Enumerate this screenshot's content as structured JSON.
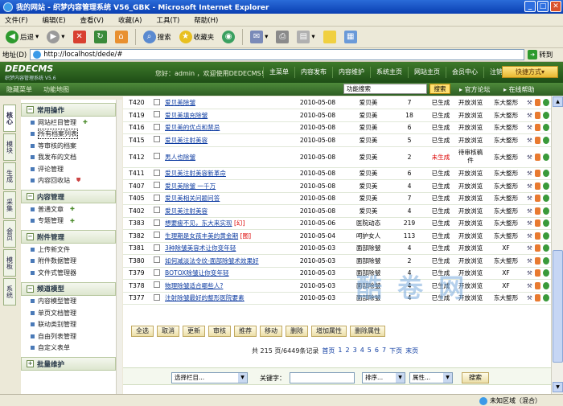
{
  "window": {
    "title": "我的网站 - 织梦内容管理系统 V56_GBK - Microsoft Internet Explorer"
  },
  "menu": [
    "文件(F)",
    "编辑(E)",
    "查看(V)",
    "收藏(A)",
    "工具(T)",
    "帮助(H)"
  ],
  "toolbar": {
    "back": "后退",
    "search": "搜索",
    "favorites": "收藏夹"
  },
  "address": {
    "label": "地址(D)",
    "url": "http://localhost/dede/#",
    "go": "转到"
  },
  "header": {
    "logo": "DEDECMS",
    "logo_sub": "织梦内容管理系统 V5.6",
    "welcome": "您好：admin ，欢迎使用DEDECMS！",
    "nav": [
      "主菜单",
      "内容发布",
      "内容维护",
      "系统主页",
      "网站主页",
      "会员中心",
      "注销"
    ],
    "quick": "快捷方式"
  },
  "subheader": {
    "links": [
      "隐藏菜单",
      "功能地图"
    ],
    "search_value": "功能搜索",
    "search_btn": "搜索",
    "forum": "官方论坛",
    "help": "在线帮助"
  },
  "vtabs": [
    "核心",
    "模块",
    "生成",
    "采集",
    "会员",
    "模板",
    "系统"
  ],
  "sidebar": [
    {
      "title": "常用操作",
      "items": [
        "网站栏目管理",
        "所有档案列表",
        "等审核的档案",
        "我发布的文档",
        "评论管理",
        "内容回收站"
      ]
    },
    {
      "title": "内容管理",
      "items": [
        "普通文章",
        "专题管理"
      ]
    },
    {
      "title": "附件管理",
      "items": [
        "上传新文件",
        "附件数据管理",
        "文件式管理器"
      ]
    },
    {
      "title": "频道模型",
      "items": [
        "内容模型管理",
        "单页文档管理",
        "联动类别管理",
        "自由列表管理",
        "自定义表单"
      ]
    },
    {
      "title": "批量维护",
      "items": []
    }
  ],
  "rows": [
    {
      "id": "T420",
      "title": "爱贝美除皱",
      "date": "2010-05-08",
      "cat": "爱贝美",
      "hits": "7",
      "status": "已生成",
      "perm": "开放浏览",
      "author": "东大整形"
    },
    {
      "id": "T419",
      "title": "爱贝美填充除皱",
      "date": "2010-05-08",
      "cat": "爱贝美",
      "hits": "18",
      "status": "已生成",
      "perm": "开放浏览",
      "author": "东大整形"
    },
    {
      "id": "T416",
      "title": "爱贝美的优点和禁忌",
      "date": "2010-05-08",
      "cat": "爱贝美",
      "hits": "6",
      "status": "已生成",
      "perm": "开放浏览",
      "author": "东大整形"
    },
    {
      "id": "T415",
      "title": "爱贝美注射美容",
      "date": "2010-05-08",
      "cat": "爱贝美",
      "hits": "5",
      "status": "已生成",
      "perm": "开放浏览",
      "author": "东大整形"
    },
    {
      "id": "T412",
      "title": "男人也除皱",
      "date": "2010-05-08",
      "cat": "爱贝美",
      "hits": "2",
      "status": "未生成",
      "perm": "待审核稿件",
      "author": "东大整形",
      "tall": true
    },
    {
      "id": "T411",
      "title": "爱贝美注射美容新革命",
      "date": "2010-05-08",
      "cat": "爱贝美",
      "hits": "6",
      "status": "已生成",
      "perm": "开放浏览",
      "author": "东大整形"
    },
    {
      "id": "T407",
      "title": "爱贝美除皱 一千万",
      "date": "2010-05-08",
      "cat": "爱贝美",
      "hits": "4",
      "status": "已生成",
      "perm": "开放浏览",
      "author": "东大整形"
    },
    {
      "id": "T405",
      "title": "爱贝美相关问题问答",
      "date": "2010-05-08",
      "cat": "爱贝美",
      "hits": "7",
      "status": "已生成",
      "perm": "开放浏览",
      "author": "东大整形"
    },
    {
      "id": "T402",
      "title": "爱贝美注射美容",
      "date": "2010-05-08",
      "cat": "爱贝美",
      "hits": "4",
      "status": "已生成",
      "perm": "开放浏览",
      "author": "东大整形"
    },
    {
      "id": "T383",
      "title": "想要瘦不见，东大来实现",
      "date": "2010-05-06",
      "cat": "医院动态",
      "hits": "219",
      "status": "已生成",
      "perm": "开放浏览",
      "author": "东大整形",
      "flag": "幻"
    },
    {
      "id": "T382",
      "title": "生理期是女孩丰美的黄金期",
      "date": "2010-05-04",
      "cat": "呵护女人",
      "hits": "113",
      "status": "已生成",
      "perm": "开放浏览",
      "author": "东大整形",
      "flag": "图"
    },
    {
      "id": "T381",
      "title": "3种除皱美容术让你变年轻",
      "date": "2010-05-03",
      "cat": "面部除皱",
      "hits": "4",
      "status": "已生成",
      "perm": "开放浏览",
      "author": "XF"
    },
    {
      "id": "T380",
      "title": "如何减淡法令纹-面部除皱术效果好",
      "date": "2010-05-03",
      "cat": "面部除皱",
      "hits": "2",
      "status": "已生成",
      "perm": "开放浏览",
      "author": "东大整形"
    },
    {
      "id": "T379",
      "title": "BOTOX除皱让你变年轻",
      "date": "2010-05-03",
      "cat": "面部除皱",
      "hits": "4",
      "status": "已生成",
      "perm": "开放浏览",
      "author": "XF"
    },
    {
      "id": "T378",
      "title": "物理除皱适合哪些人?",
      "date": "2010-05-03",
      "cat": "面部除皱",
      "hits": "4",
      "status": "已生成",
      "perm": "开放浏览",
      "author": "XF"
    },
    {
      "id": "T377",
      "title": "注射除皱最好的整形医院要素",
      "date": "2010-05-03",
      "cat": "面部除皱",
      "hits": "4",
      "status": "已生成",
      "perm": "开放浏览",
      "author": "东大整形"
    }
  ],
  "actions": [
    "全选",
    "取消",
    "更新",
    "审核",
    "推荐",
    "移动",
    "删除",
    "增加属性",
    "删除属性"
  ],
  "pager": {
    "summary": "共 215 页/6449条记录",
    "first": "首页",
    "pages": [
      "1",
      "2",
      "3",
      "4",
      "5",
      "6",
      "7"
    ],
    "next": "下页",
    "last": "末页"
  },
  "filter": {
    "category": "选择栏目...",
    "keyword_label": "关键字：",
    "order": "排序...",
    "attr": "属性...",
    "search": "搜索"
  },
  "status": {
    "zone": "未知区域（混合）"
  },
  "watermark": "酷 卷 网"
}
